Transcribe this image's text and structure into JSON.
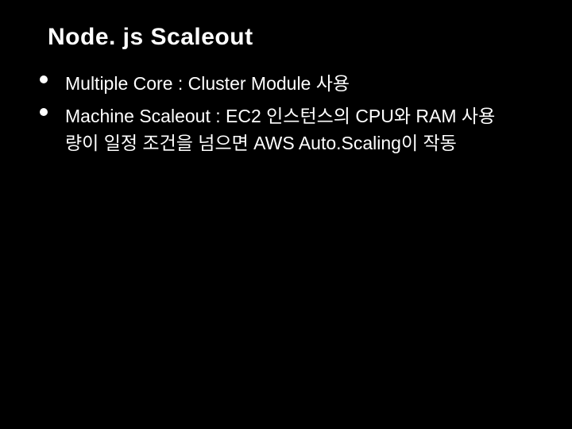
{
  "slide": {
    "title": "Node. js Scaleout",
    "bullets": [
      "Multiple Core : Cluster Module 사용",
      "Machine Scaleout : EC2 인스턴스의 CPU와 RAM 사용량이 일정 조건을 넘으면 AWS Auto.Scaling이 작동"
    ]
  }
}
